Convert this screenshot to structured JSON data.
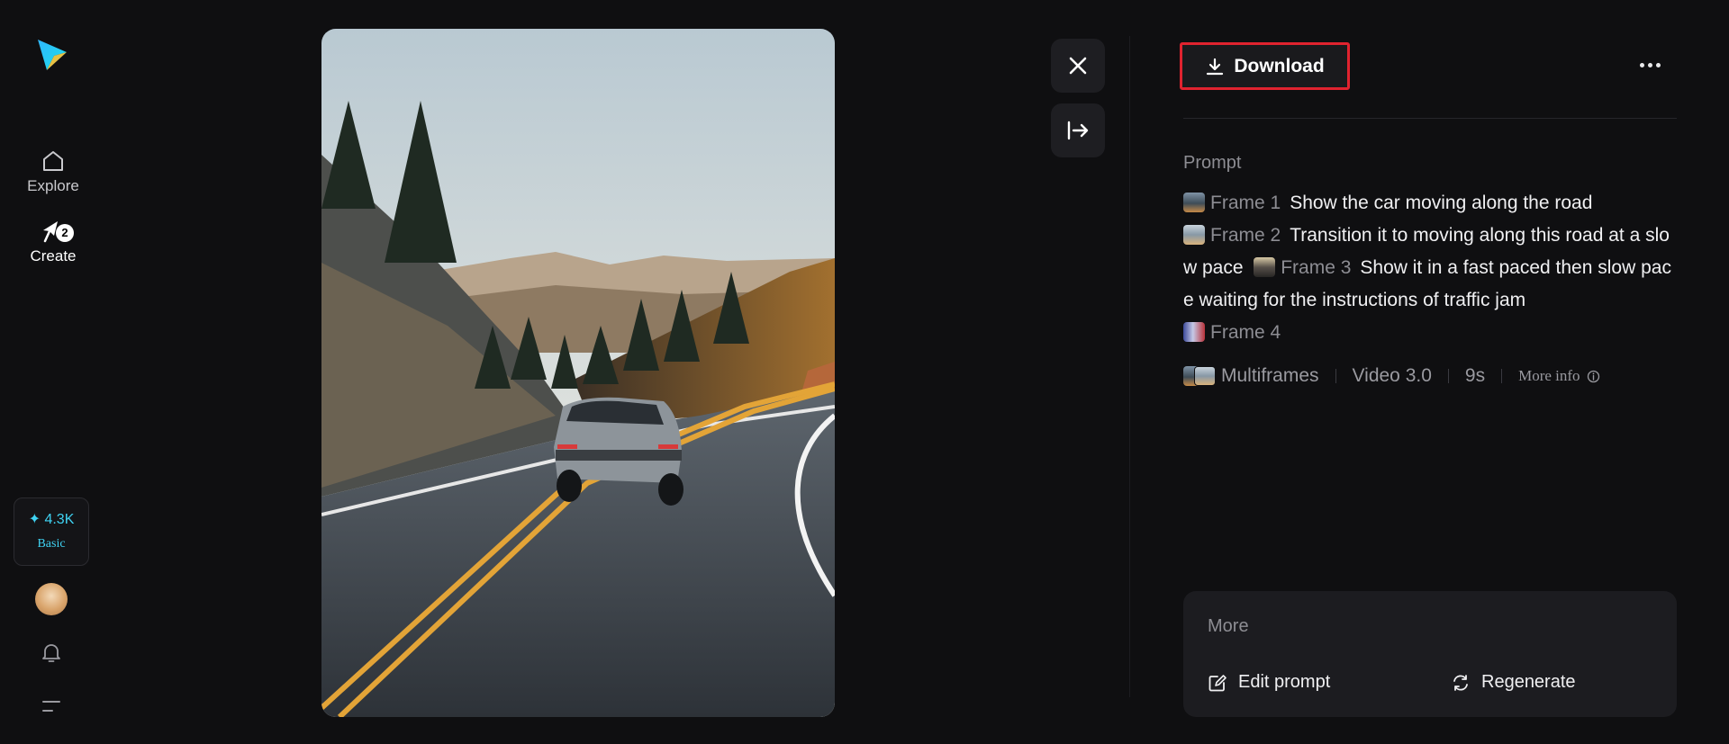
{
  "sidebar": {
    "items": [
      {
        "label": "Explore",
        "icon": "home-icon"
      },
      {
        "label": "Create",
        "icon": "create-icon",
        "badge": "2"
      }
    ],
    "credits": {
      "amount": "✦ 4.3K",
      "plan": "Basic"
    }
  },
  "toolbar": {
    "download_label": "Download"
  },
  "prompt": {
    "label": "Prompt",
    "segments": [
      {
        "frame": "Frame 1",
        "text": "Show the car moving along the road"
      },
      {
        "frame": "Frame 2",
        "text": "Transition it to moving along this road at a slow pace"
      },
      {
        "frame": "Frame 3",
        "text": "Show it in a fast paced then slow pace waiting for the instructions of traffic jam"
      },
      {
        "frame": "Frame 4",
        "text": ""
      }
    ]
  },
  "meta": {
    "mode": "Multiframes",
    "model": "Video 3.0",
    "duration": "9s",
    "more_info": "More info"
  },
  "more_card": {
    "title": "More",
    "edit_label": "Edit prompt",
    "regenerate_label": "Regenerate"
  },
  "colors": {
    "background": "#0f0f11",
    "accent": "#3fd2f2",
    "highlight": "#e0232f",
    "panel": "#1c1c20"
  }
}
